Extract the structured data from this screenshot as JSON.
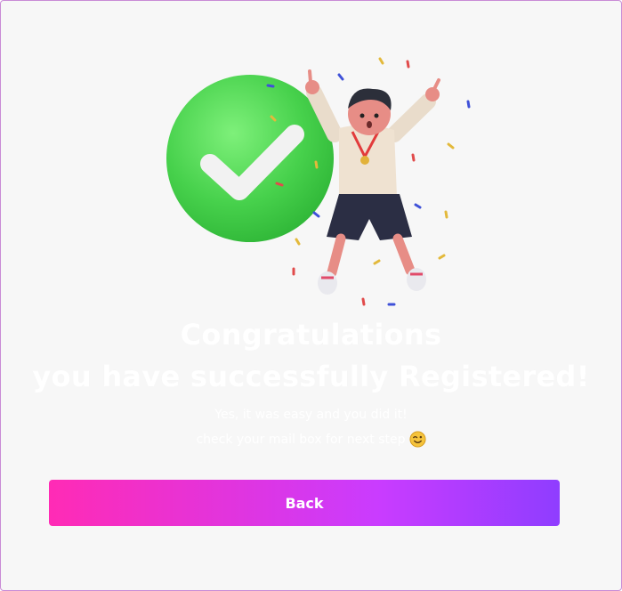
{
  "success": {
    "title_line1": "Congratulations",
    "title_line2": "you have successfully Registered!",
    "message_line1": "Yes, it was easy and you did it!",
    "message_line2": "check your mail box for next step"
  },
  "actions": {
    "back_label": "Back"
  },
  "icons": {
    "illustration": "checkmark-badge-celebrating-person",
    "emoji": "wink-emoji"
  },
  "colors": {
    "background": "#f7f7f7",
    "frame_border": "#c98bd6",
    "button_gradient_start": "#ff2bb5",
    "button_gradient_end": "#8f3dff",
    "check_green": "#4fd65a"
  }
}
